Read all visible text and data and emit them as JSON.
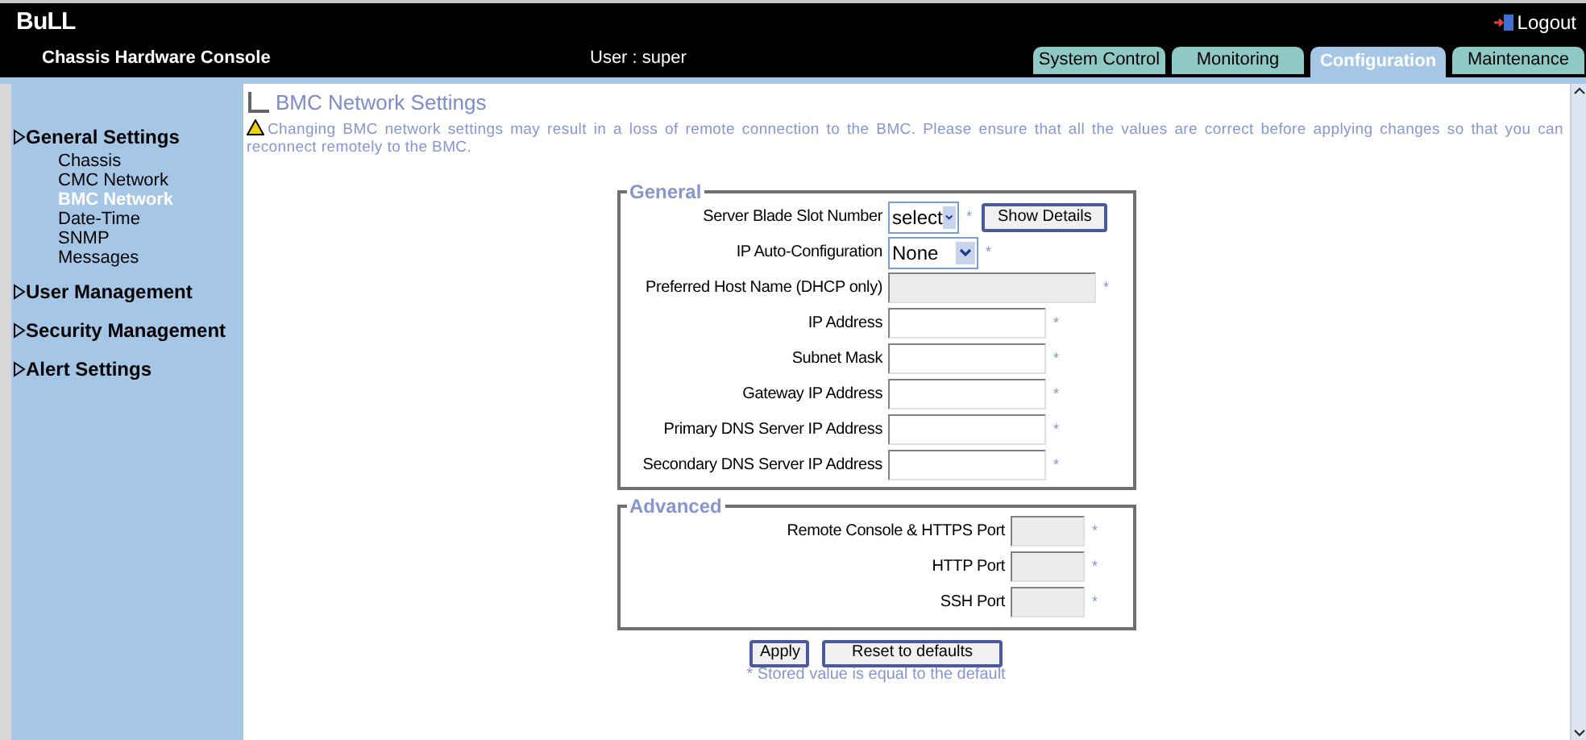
{
  "header": {
    "logo": "BuLL",
    "title": "Chassis Hardware Console",
    "user": "User : super",
    "logout": "Logout"
  },
  "tabs": [
    {
      "label": "System Control",
      "selected": false
    },
    {
      "label": "Monitoring",
      "selected": false
    },
    {
      "label": "Configuration",
      "selected": true
    },
    {
      "label": "Maintenance",
      "selected": false
    }
  ],
  "sidebar": {
    "sections": [
      {
        "label": "General Settings",
        "children": [
          {
            "label": "Chassis",
            "selected": false
          },
          {
            "label": "CMC Network",
            "selected": false
          },
          {
            "label": "BMC Network",
            "selected": true
          },
          {
            "label": "Date-Time",
            "selected": false
          },
          {
            "label": "SNMP",
            "selected": false
          },
          {
            "label": "Messages",
            "selected": false
          }
        ]
      },
      {
        "label": "User Management"
      },
      {
        "label": "Security Management"
      },
      {
        "label": "Alert Settings"
      }
    ]
  },
  "page": {
    "title": "BMC Network Settings",
    "warning": "Changing BMC network settings may result in a loss of remote connection to the BMC. Please ensure that all the values are correct before applying changes so that you can reconnect remotely to the BMC."
  },
  "groups": [
    {
      "legend": "General",
      "rows": [
        {
          "label": "Server Blade Slot Number",
          "kind": "select",
          "value": "select",
          "marker": "*",
          "button": "Show Details"
        },
        {
          "label": "IP Auto-Configuration",
          "kind": "select",
          "value": "None",
          "marker": "*"
        },
        {
          "label": "Preferred Host Name (DHCP only)",
          "kind": "text",
          "disabled": true,
          "marker": "*"
        },
        {
          "label": "IP Address",
          "kind": "text",
          "disabled": false,
          "marker": "*"
        },
        {
          "label": "Subnet Mask",
          "kind": "text",
          "disabled": false,
          "marker": "*"
        },
        {
          "label": "Gateway IP Address",
          "kind": "text",
          "disabled": false,
          "marker": "*"
        },
        {
          "label": "Primary DNS Server IP Address",
          "kind": "text",
          "disabled": false,
          "marker": "*"
        },
        {
          "label": "Secondary DNS Server IP Address",
          "kind": "text",
          "disabled": false,
          "marker": "*"
        }
      ]
    },
    {
      "legend": "Advanced",
      "rows": [
        {
          "label": "Remote Console & HTTPS Port",
          "kind": "port",
          "disabled": true,
          "marker": "*"
        },
        {
          "label": "HTTP Port",
          "kind": "port",
          "disabled": true,
          "marker": "*"
        },
        {
          "label": "SSH Port",
          "kind": "port",
          "disabled": true,
          "marker": "*"
        }
      ]
    }
  ],
  "buttons": [
    "Apply",
    "Reset to defaults"
  ],
  "footnote": "* Stored value is equal to the default"
}
